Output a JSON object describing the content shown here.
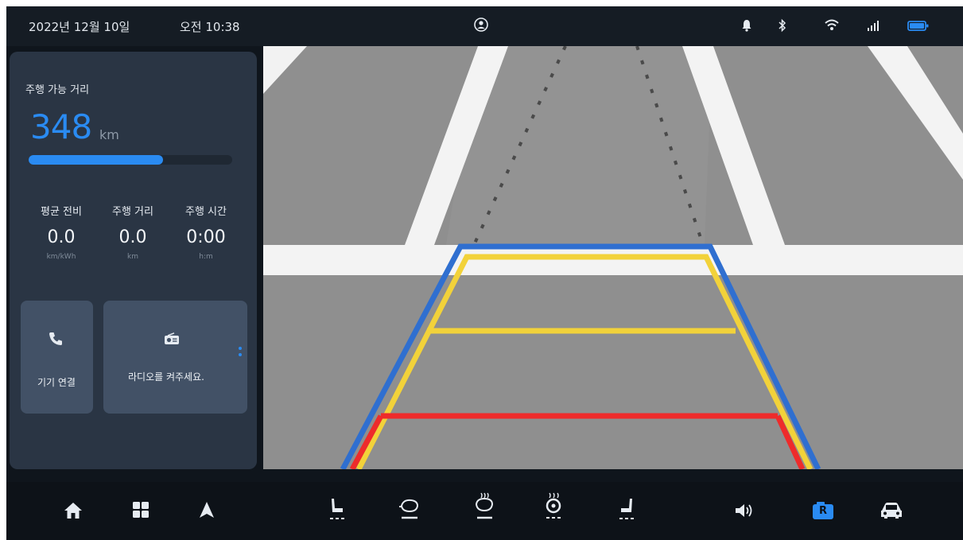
{
  "status": {
    "date": "2022년 12월 10일",
    "time": "오전 10:38",
    "icons": [
      "profile-icon",
      "bell-icon",
      "bluetooth-icon",
      "wifi-icon",
      "signal-icon",
      "battery-icon"
    ],
    "accent": "#2a8bf2"
  },
  "range": {
    "label": "주행 가능 거리",
    "value": "348",
    "unit": "km",
    "fill_fraction": 0.66
  },
  "stats": [
    {
      "label": "평균 전비",
      "value": "0.0",
      "unit": "km/kWh"
    },
    {
      "label": "주행 거리",
      "value": "0.0",
      "unit": "km"
    },
    {
      "label": "주행 시간",
      "value": "0:00",
      "unit": "h:m"
    }
  ],
  "tiles": {
    "device": {
      "label": "기기 연결",
      "icon": "phone-icon"
    },
    "radio": {
      "label": "라디오를 켜주세요.",
      "icon": "radio-icon"
    }
  },
  "page_dots": {
    "count": 2,
    "active": 0
  },
  "camera": {
    "view": "rear-camera",
    "guide_colors": {
      "outer": "#2f6fd0",
      "middle": "#f2d23a",
      "near": "#ee2b2b"
    }
  },
  "bottom_nav": [
    {
      "name": "home-icon"
    },
    {
      "name": "apps-grid-icon"
    },
    {
      "name": "navigation-arrow-icon"
    },
    {
      "name": "seat-heat-driver-icon"
    },
    {
      "name": "mirror-heat-icon"
    },
    {
      "name": "rear-defrost-icon"
    },
    {
      "name": "steering-heat-icon"
    },
    {
      "name": "seat-heat-passenger-icon"
    },
    {
      "name": "volume-icon"
    },
    {
      "name": "rear-camera-icon",
      "label": "R"
    },
    {
      "name": "car-icon"
    }
  ]
}
